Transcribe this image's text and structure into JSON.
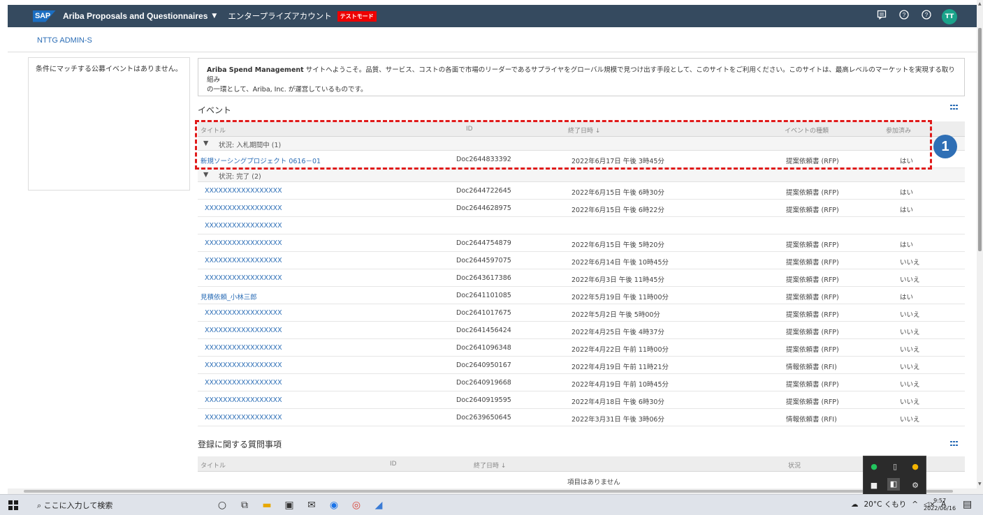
{
  "header": {
    "logo": "SAP",
    "app_title": "Ariba Proposals and Questionnaires",
    "enterprise": "エンタープライズアカウント",
    "test_mode": "テストモード",
    "avatar": "TT",
    "icons": [
      "notification-icon",
      "help-icon",
      "help-icon-2"
    ]
  },
  "breadcrumb": "NTTG ADMIN-S",
  "left_panel": {
    "message": "条件にマッチする公募イベントはありません。"
  },
  "welcome": {
    "brand": "Ariba Spend Management",
    "line1": " サイトへようこそ。品質、サービス、コストの各面で市場のリーダーであるサプライヤをグローバル規模で見つけ出す手段として、このサイトをご利用ください。このサイトは、最高レベルのマーケットを実現する取り組み",
    "line2": "の一環として、Ariba, Inc. が運営しているものです。"
  },
  "events": {
    "title": "イベント",
    "columns": {
      "title": "タイトル",
      "id": "ID",
      "end_date": "終了日時 ↓",
      "type": "イベントの種類",
      "joined": "参加済み"
    },
    "group_open": "状況: 入札期間中 (1)",
    "group_done": "状況: 完了 (2)",
    "open_rows": [
      {
        "title": "新規ソーシングプロジェクト 0616－01",
        "id": "Doc2644833392",
        "end": "2022年6月17日 午後 3時45分",
        "type": "提案依頼書 (RFP)",
        "joined": "はい"
      }
    ],
    "done_rows": [
      {
        "title": "XXXXXXXXXXXXXXXXX",
        "id": "Doc2644722645",
        "end": "2022年6月15日 午後 6時30分",
        "type": "提案依頼書 (RFP)",
        "joined": "はい"
      },
      {
        "title": "XXXXXXXXXXXXXXXXX",
        "id": "Doc2644628975",
        "end": "2022年6月15日 午後 6時22分",
        "type": "提案依頼書 (RFP)",
        "joined": "はい"
      },
      {
        "title": "XXXXXXXXXXXXXXXXX",
        "id": "",
        "end": "",
        "type": "",
        "joined": ""
      },
      {
        "title": "XXXXXXXXXXXXXXXXX",
        "id": "Doc2644754879",
        "end": "2022年6月15日 午後 5時20分",
        "type": "提案依頼書 (RFP)",
        "joined": "はい"
      },
      {
        "title": "XXXXXXXXXXXXXXXXX",
        "id": "Doc2644597075",
        "end": "2022年6月14日 午後 10時45分",
        "type": "提案依頼書 (RFP)",
        "joined": "いいえ"
      },
      {
        "title": "XXXXXXXXXXXXXXXXX",
        "id": "Doc2643617386",
        "end": "2022年6月3日 午後 11時45分",
        "type": "提案依頼書 (RFP)",
        "joined": "いいえ"
      },
      {
        "title": "見積依頼_小林三郎",
        "id": "Doc2641101085",
        "end": "2022年5月19日 午後 11時00分",
        "type": "提案依頼書 (RFP)",
        "joined": "はい"
      },
      {
        "title": "XXXXXXXXXXXXXXXXX",
        "id": "Doc2641017675",
        "end": "2022年5月2日 午後 5時00分",
        "type": "提案依頼書 (RFP)",
        "joined": "いいえ"
      },
      {
        "title": "XXXXXXXXXXXXXXXXX",
        "id": "Doc2641456424",
        "end": "2022年4月25日 午後 4時37分",
        "type": "提案依頼書 (RFP)",
        "joined": "いいえ"
      },
      {
        "title": "XXXXXXXXXXXXXXXXX",
        "id": "Doc2641096348",
        "end": "2022年4月22日 午前 11時00分",
        "type": "提案依頼書 (RFP)",
        "joined": "いいえ"
      },
      {
        "title": "XXXXXXXXXXXXXXXXX",
        "id": "Doc2640950167",
        "end": "2022年4月19日 午前 11時21分",
        "type": "情報依頼書 (RFI)",
        "joined": "いいえ"
      },
      {
        "title": "XXXXXXXXXXXXXXXXX",
        "id": "Doc2640919668",
        "end": "2022年4月19日 午前 10時45分",
        "type": "提案依頼書 (RFP)",
        "joined": "いいえ"
      },
      {
        "title": "XXXXXXXXXXXXXXXXX",
        "id": "Doc2640919595",
        "end": "2022年4月18日 午後 6時30分",
        "type": "提案依頼書 (RFP)",
        "joined": "いいえ"
      },
      {
        "title": "XXXXXXXXXXXXXXXXX",
        "id": "Doc2639650645",
        "end": "2022年3月31日 午後 3時06分",
        "type": "情報依頼書 (RFI)",
        "joined": "いいえ"
      }
    ]
  },
  "registration": {
    "title": "登録に関する質問事項",
    "columns": {
      "title": "タイトル",
      "id": "ID",
      "end_date": "終了日時 ↓",
      "status": "状況"
    },
    "empty": "項目はありません"
  },
  "annotation": {
    "badge": "1",
    "color": "#e01a1a"
  },
  "taskbar": {
    "search_placeholder": "ここに入力して検索",
    "weather": "20°C くもり",
    "ime": "A",
    "time": "9:57",
    "date": "2022/06/16"
  },
  "colors": {
    "header_bg": "#354a5f",
    "link": "#2b6db6",
    "avatar": "#1aa38a",
    "test_mode": "#ee0000"
  }
}
